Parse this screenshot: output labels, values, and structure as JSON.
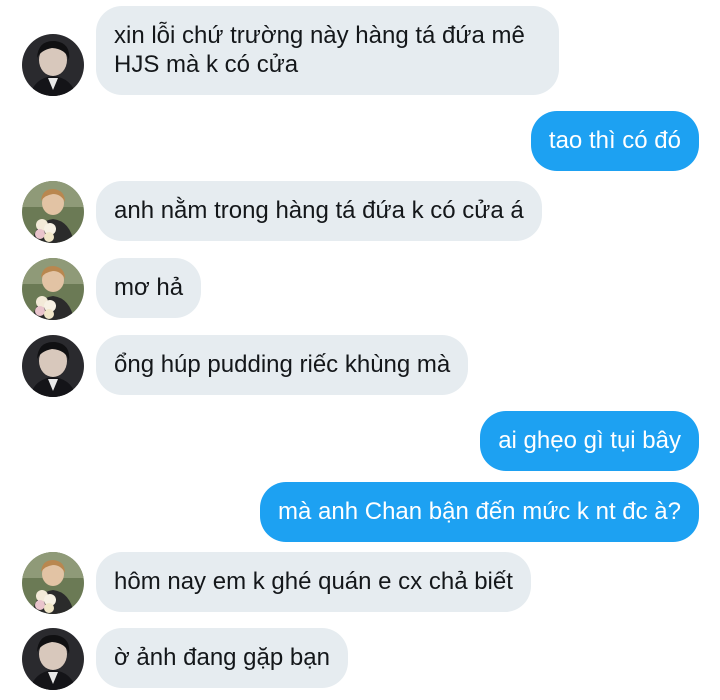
{
  "conversation": {
    "messages": [
      {
        "direction": "in",
        "avatar": "boy-avatar-dark",
        "text": "xin lỗi chứ trường này hàng tá đứa mê HJS mà k có cửa"
      },
      {
        "direction": "out",
        "text": "tao thì có đó"
      },
      {
        "direction": "in",
        "avatar": "flowers-avatar",
        "text": "anh nằm trong hàng tá đứa k có cửa á"
      },
      {
        "direction": "in",
        "avatar": "flowers-avatar",
        "text": "mơ hả"
      },
      {
        "direction": "in",
        "avatar": "boy-avatar-dark",
        "text": "ổng húp pudding riếc khùng mà"
      },
      {
        "direction": "out",
        "text": "ai ghẹo gì tụi bây"
      },
      {
        "direction": "out",
        "text": "mà anh Chan bận đến mức k nt đc à?"
      },
      {
        "direction": "in",
        "avatar": "flowers-avatar",
        "text": "hôm nay em k ghé quán e cx chả biết"
      },
      {
        "direction": "in",
        "avatar": "boy-avatar-dark",
        "text": "ờ ảnh đang gặp bạn"
      }
    ]
  },
  "colors": {
    "incoming_bubble": "#e6ecf0",
    "outgoing_bubble": "#1da1f2",
    "incoming_text": "#14171a",
    "outgoing_text": "#ffffff",
    "background": "#ffffff"
  }
}
